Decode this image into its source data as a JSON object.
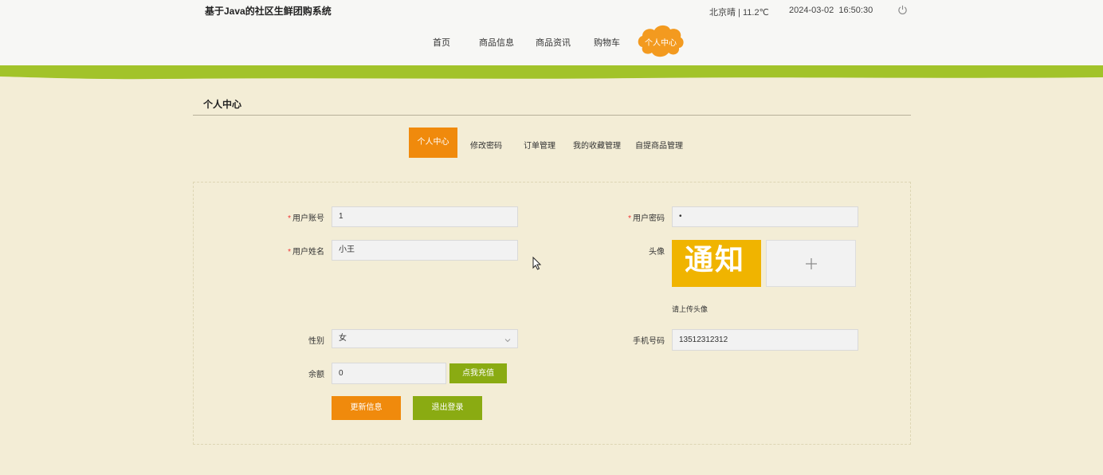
{
  "header": {
    "site_title": "基于Java的社区生鲜团购系统",
    "weather": "北京晴 | 11.2℃",
    "datetime": "2024-03-02  16:50:30",
    "power_icon": "power-icon"
  },
  "nav": {
    "items": [
      "首页",
      "商品信息",
      "商品资讯",
      "购物车"
    ],
    "active": "个人中心",
    "active_color": "#f39a1f"
  },
  "colors": {
    "background": "#f3edd6",
    "green_band": "#a2c32a",
    "accent_orange": "#f08a0c",
    "accent_green": "#8aab12"
  },
  "section": {
    "title": "个人中心"
  },
  "tabs": {
    "active": "个人中心",
    "items": [
      "修改密码",
      "订单管理",
      "我的收藏管理",
      "自提商品管理"
    ]
  },
  "form": {
    "account": {
      "label": "用户账号",
      "value": "1",
      "required_mark": "*"
    },
    "password": {
      "label": "用户密码",
      "value": "•",
      "required_mark": "*"
    },
    "name": {
      "label": "用户姓名",
      "value": "小王",
      "required_mark": "*"
    },
    "avatar": {
      "label": "头像",
      "image_text": "通知",
      "upload_icon": "plus-icon",
      "hint": "请上传头像"
    },
    "gender": {
      "label": "性别",
      "value": "女",
      "arrow_icon": "chevron-down-icon"
    },
    "phone": {
      "label": "手机号码",
      "value": "13512312312"
    },
    "balance": {
      "label": "余额",
      "value": "0",
      "recharge_label": "点我充值"
    },
    "update_label": "更新信息",
    "logout_label": "退出登录"
  }
}
